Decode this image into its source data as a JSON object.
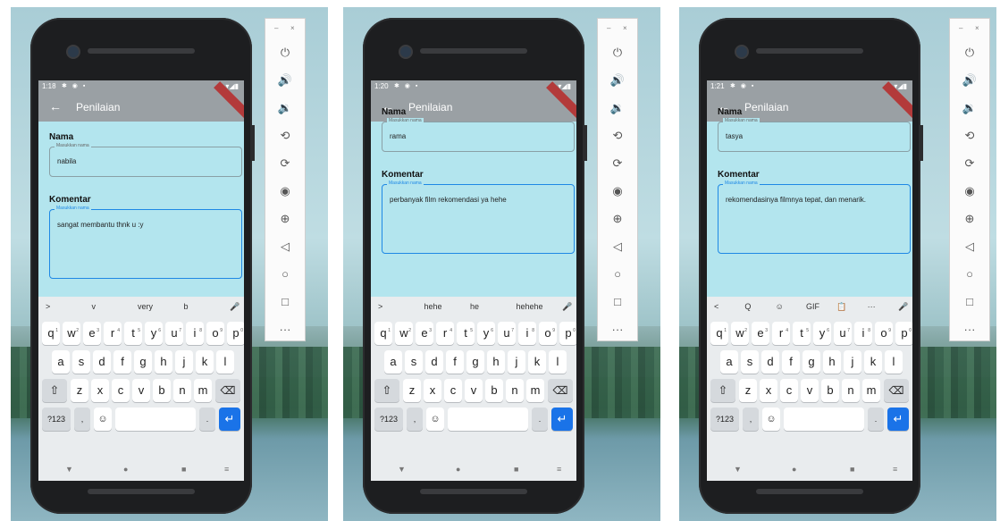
{
  "panels": [
    {
      "time": "1:18",
      "status_icons": "✱ ◉ ▪",
      "signal": "▾◢▮",
      "app_title": "Penilaian",
      "nama_label": "Nama",
      "nama_hint": "Masukkan nama",
      "nama_value": "nabila",
      "komentar_label": "Komentar",
      "komentar_hint": "Masukkan nama",
      "komentar_value": "sangat membantu thnk u :y",
      "suggestions": [
        ">",
        "v",
        "very",
        "b",
        "🎤"
      ]
    },
    {
      "time": "1:20",
      "status_icons": "✱ ◉ ▪",
      "signal": "▾◢▮",
      "app_title": "Penilaian",
      "nama_label": "Nama",
      "nama_hint": "Masukkan nama",
      "nama_value": "rama",
      "komentar_label": "Komentar",
      "komentar_hint": "Masukkan nama",
      "komentar_value": "perbanyak film rekomendasi ya hehe",
      "suggestions": [
        ">",
        "hehe",
        "he",
        "hehehe",
        "🎤"
      ]
    },
    {
      "time": "1:21",
      "status_icons": "✱ ◉ ▪",
      "signal": "▾◢▮",
      "app_title": "Penilaian",
      "nama_label": "Nama",
      "nama_hint": "Masukkan nama",
      "nama_value": "tasya",
      "komentar_label": "Komentar",
      "komentar_hint": "Masukkan nama",
      "komentar_value": "rekomendasinya filmnya tepat, dan menarik.",
      "suggestions": [
        "<",
        "Q",
        "☺",
        "GIF",
        "📋",
        "···",
        "🎤"
      ]
    }
  ],
  "keyboard": {
    "row1": [
      "q",
      "w",
      "e",
      "r",
      "t",
      "y",
      "u",
      "i",
      "o",
      "p"
    ],
    "row1_hints": [
      "1",
      "2",
      "3",
      "4",
      "5",
      "6",
      "7",
      "8",
      "9",
      "0"
    ],
    "row2": [
      "a",
      "s",
      "d",
      "f",
      "g",
      "h",
      "j",
      "k",
      "l"
    ],
    "row3": [
      "z",
      "x",
      "c",
      "v",
      "b",
      "n",
      "m"
    ],
    "shift": "⇧",
    "backspace": "⌫",
    "symbols": "?123",
    "comma": ",",
    "emoji": "☺",
    "period": ".",
    "enter": "↵"
  },
  "navbar": [
    "▼",
    "●",
    "■",
    "≡"
  ],
  "emulator_toolbar": {
    "minimize": "–",
    "close": "×",
    "tools": [
      {
        "name": "power-icon",
        "glyph": "⏻"
      },
      {
        "name": "volume-up-icon",
        "glyph": "🔊"
      },
      {
        "name": "volume-down-icon",
        "glyph": "🔉"
      },
      {
        "name": "rotate-left-icon",
        "glyph": "⟲"
      },
      {
        "name": "rotate-right-icon",
        "glyph": "⟳"
      },
      {
        "name": "camera-icon",
        "glyph": "◉"
      },
      {
        "name": "zoom-icon",
        "glyph": "⊕"
      },
      {
        "name": "back-icon",
        "glyph": "◁"
      },
      {
        "name": "home-icon",
        "glyph": "○"
      },
      {
        "name": "overview-icon",
        "glyph": "□"
      },
      {
        "name": "more-icon",
        "glyph": "···"
      }
    ]
  }
}
